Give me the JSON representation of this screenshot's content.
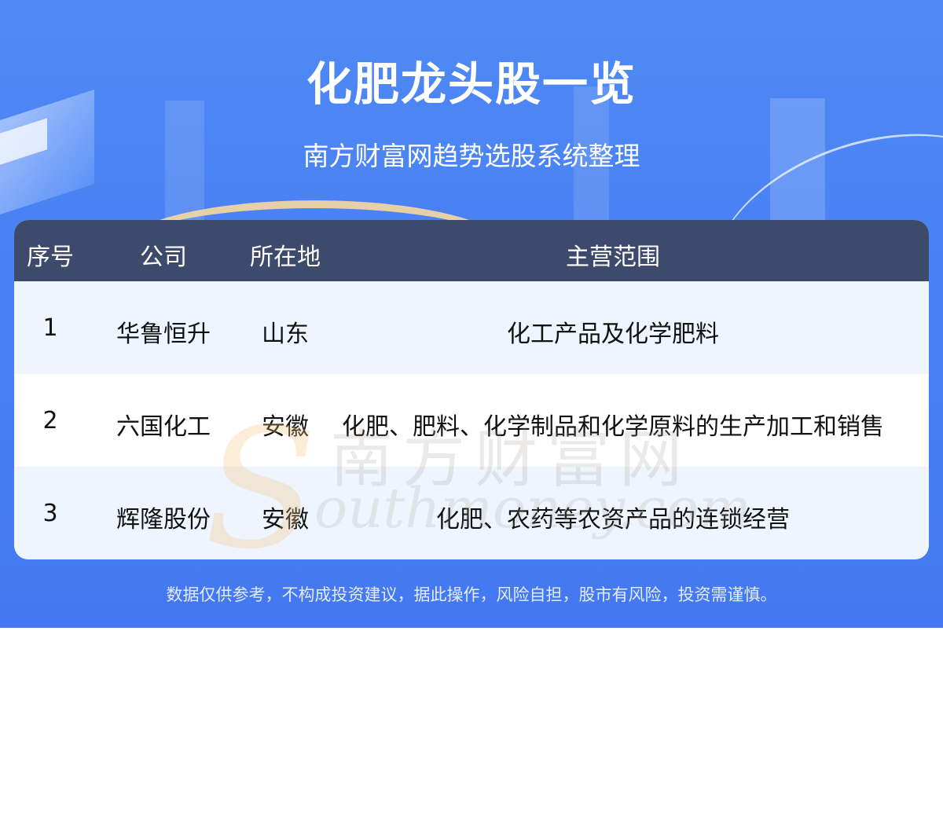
{
  "header": {
    "title": "化肥龙头股一览",
    "subtitle": "南方财富网趋势选股系统整理"
  },
  "table": {
    "columns": [
      "序号",
      "公司",
      "所在地",
      "主营范围"
    ],
    "rows": [
      {
        "index": "1",
        "company": "华鲁恒升",
        "location": "山东",
        "scope": "化工产品及化学肥料"
      },
      {
        "index": "2",
        "company": "六国化工",
        "location": "安徽",
        "scope": "化肥、肥料、化学制品和化学原料的生产加工和销售"
      },
      {
        "index": "3",
        "company": "辉隆股份",
        "location": "安徽",
        "scope": "化肥、农药等农资产品的连锁经营"
      }
    ]
  },
  "watermark": {
    "cn": "南方财富网",
    "en": "outhmoney.com"
  },
  "footer": {
    "disclaimer": "数据仅供参考，不构成投资建议，据此操作，风险自担，股市有风险，投资需谨慎。"
  },
  "colors": {
    "banner": "#4a82f3",
    "table_header": "#3d4a6b",
    "row_alt": "#eef5fe",
    "row_plain": "#ffffff"
  }
}
